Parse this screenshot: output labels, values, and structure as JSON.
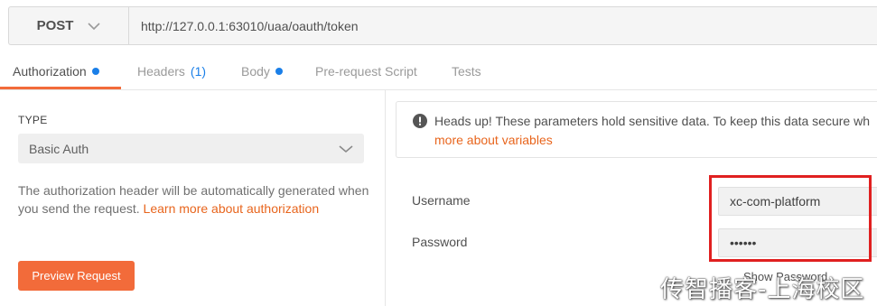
{
  "request": {
    "method": "POST",
    "url": "http://127.0.0.1:63010/uaa/oauth/token"
  },
  "tabs": [
    {
      "label": "Authorization",
      "active": true,
      "dot": true
    },
    {
      "label": "Headers",
      "count": "(1)"
    },
    {
      "label": "Body",
      "dot": true
    },
    {
      "label": "Pre-request Script"
    },
    {
      "label": "Tests"
    }
  ],
  "auth": {
    "type_label": "TYPE",
    "selected_type": "Basic Auth",
    "description": "The authorization header will be automatically generated when you send the request.",
    "learn_more": "Learn more about authorization",
    "preview_button": "Preview Request"
  },
  "notice": {
    "text": "Heads up! These parameters hold sensitive data. To keep this data secure wh",
    "link": "more about variables"
  },
  "credentials": {
    "username_label": "Username",
    "username_value": "xc-com-platform",
    "password_label": "Password",
    "password_value": "••••••",
    "show_password": "Show Password"
  },
  "watermark": "传智播客-上海校区",
  "colors": {
    "accent": "#f26b3a",
    "link": "#e8651d",
    "dot": "#1a7fe8",
    "highlight_box": "#e02020"
  }
}
